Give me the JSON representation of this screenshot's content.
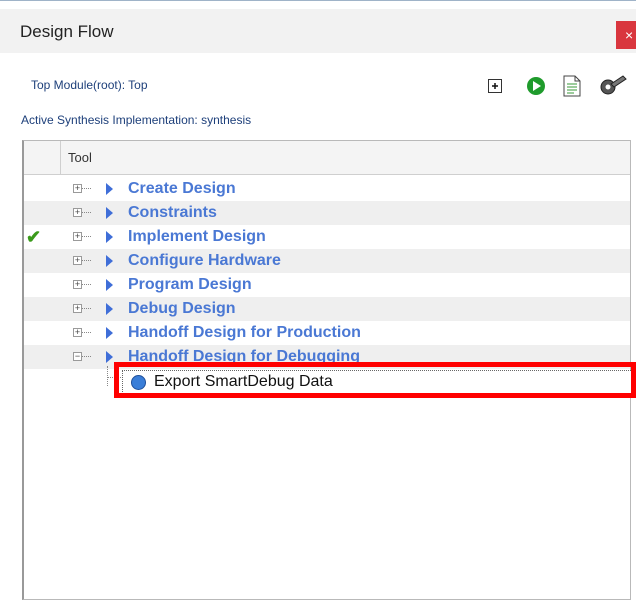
{
  "panel": {
    "title": "Design Flow",
    "close_label": "×",
    "top_module": "Top Module(root): Top",
    "active_synthesis": "Active Synthesis Implementation: synthesis"
  },
  "toolbar": {
    "icons": [
      "expand-all-icon",
      "run-icon",
      "report-icon",
      "options-icon"
    ]
  },
  "tree": {
    "column_header": "Tool",
    "expand_symbol": "+",
    "collapse_symbol": "−",
    "check_symbol": "✔",
    "items": [
      {
        "label": "Create Design",
        "status": ""
      },
      {
        "label": "Constraints",
        "status": ""
      },
      {
        "label": "Implement Design",
        "status": "complete"
      },
      {
        "label": "Configure Hardware",
        "status": ""
      },
      {
        "label": "Program Design",
        "status": ""
      },
      {
        "label": "Debug Design",
        "status": ""
      },
      {
        "label": "Handoff Design for Production",
        "status": ""
      },
      {
        "label": "Handoff Design for Debugging",
        "status": "",
        "expanded": true
      }
    ],
    "child_item": {
      "label": "Export SmartDebug Data"
    }
  },
  "colors": {
    "item_text": "#4a78d4",
    "highlight": "#ff0000",
    "check": "#3a9a1a",
    "close_bg": "#d9363e"
  }
}
